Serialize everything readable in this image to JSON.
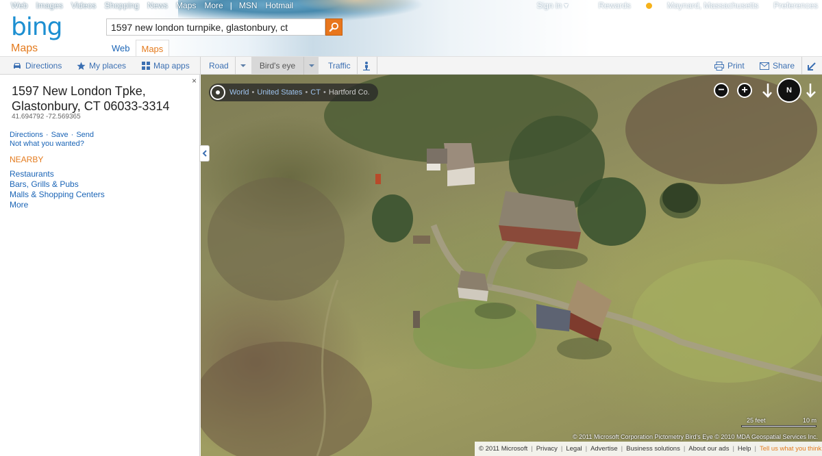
{
  "topnav": {
    "links": [
      "Web",
      "Images",
      "Videos",
      "Shopping",
      "News",
      "Maps",
      "More"
    ],
    "msn": "MSN",
    "hotmail": "Hotmail",
    "signin": "Sign in ▾",
    "rewards": "Rewards",
    "location": "Maynard, Massachusetts",
    "preferences": "Preferences"
  },
  "logo": {
    "text": "bing",
    "sub": "Maps"
  },
  "search": {
    "value": "1597 new london turnpike, glastonbury, ct"
  },
  "tabs": [
    {
      "label": "Web"
    },
    {
      "label": "Maps"
    }
  ],
  "toolbar": {
    "directions": "Directions",
    "my_places": "My places",
    "map_apps": "Map apps",
    "road": "Road",
    "birds_eye": "Bird's eye",
    "traffic": "Traffic",
    "print": "Print",
    "share": "Share"
  },
  "panel": {
    "close": "×",
    "address_line1": "1597 New London Tpke,",
    "address_line2": "Glastonbury, CT 06033-3314",
    "coordinates": "41.694792 -72.569365",
    "actions": [
      "Directions",
      "Save",
      "Send"
    ],
    "not_wanted": "Not what you wanted?",
    "nearby_heading": "NEARBY",
    "nearby": [
      "Restaurants",
      "Bars, Grills & Pubs",
      "Malls & Shopping Centers",
      "More"
    ]
  },
  "map": {
    "breadcrumb": [
      "World",
      "United States",
      "CT",
      "Hartford Co."
    ],
    "zoom_out": "−",
    "zoom_in": "+",
    "compass": "N",
    "scale_left": "25 feet",
    "scale_right": "10 m",
    "credit": "© 2011 Microsoft Corporation   Pictometry Bird's Eye © 2010 MDA Geospatial Services Inc."
  },
  "footer": {
    "items": [
      "© 2011 Microsoft",
      "Privacy",
      "Legal",
      "Advertise",
      "Business solutions",
      "About our ads",
      "Help"
    ],
    "feedback": "Tell us what you think"
  }
}
